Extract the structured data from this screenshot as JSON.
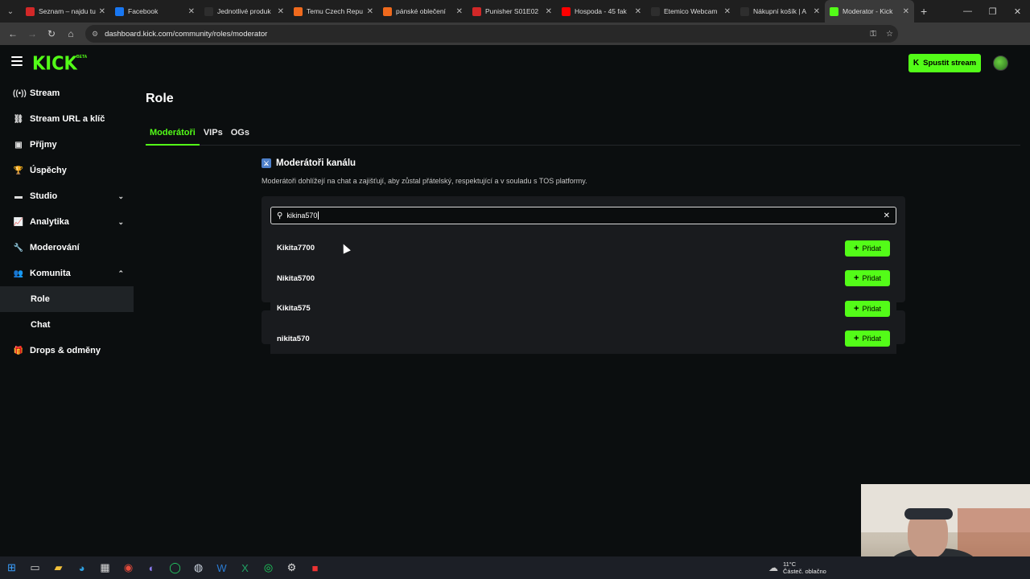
{
  "browser": {
    "tabs": [
      {
        "title": "Seznam – najdu tu",
        "favicon_color": "#d22828",
        "active": false
      },
      {
        "title": "Facebook",
        "favicon_color": "#1877f2",
        "active": false
      },
      {
        "title": "Jednotlivé produk",
        "favicon_color": "#2e2e2e",
        "active": false
      },
      {
        "title": "Temu Czech Repu",
        "favicon_color": "#f06a1d",
        "active": false
      },
      {
        "title": "pánské oblečení",
        "favicon_color": "#f06a1d",
        "active": false
      },
      {
        "title": "Punisher S01E02",
        "favicon_color": "#d22828",
        "active": false
      },
      {
        "title": "Hospoda - 45 fak",
        "favicon_color": "#ff0000",
        "active": false
      },
      {
        "title": "Etemico Webcam",
        "favicon_color": "#2e2e2e",
        "active": false
      },
      {
        "title": "Nákupní košík | A",
        "favicon_color": "#2e2e2e",
        "active": false
      },
      {
        "title": "Moderator - Kick",
        "favicon_color": "#53fc18",
        "active": true
      }
    ],
    "url": "dashboard.kick.com/community/roles/moderator"
  },
  "header": {
    "logo": "KICK",
    "logo_badge": "BETA",
    "stream_button": "Spustit stream"
  },
  "sidebar": {
    "items": [
      {
        "label": "Stream",
        "icon": "broadcast-icon",
        "glyph": "((•))"
      },
      {
        "label": "Stream URL a klíč",
        "icon": "link-icon",
        "glyph": "⛓"
      },
      {
        "label": "Příjmy",
        "icon": "wallet-icon",
        "glyph": "▣"
      },
      {
        "label": "Úspěchy",
        "icon": "trophy-icon",
        "glyph": "🏆"
      },
      {
        "label": "Studio",
        "icon": "studio-icon",
        "glyph": "▬",
        "chevron": "down"
      },
      {
        "label": "Analytika",
        "icon": "analytics-icon",
        "glyph": "📈",
        "chevron": "down"
      },
      {
        "label": "Moderování",
        "icon": "wrench-icon",
        "glyph": "🔧"
      },
      {
        "label": "Komunita",
        "icon": "community-icon",
        "glyph": "👥",
        "chevron": "up"
      },
      {
        "label": "Role",
        "sub": true,
        "active": true
      },
      {
        "label": "Chat",
        "sub": true
      },
      {
        "label": "Drops & odměny",
        "icon": "gift-icon",
        "glyph": "🎁"
      }
    ]
  },
  "main": {
    "title": "Role",
    "tabs": [
      "Moderátoři",
      "VIPs",
      "OGs"
    ],
    "section_title": "Moderátoři kanálu",
    "section_desc": "Moderátoři dohlížejí na chat a zajišťují, aby zůstal přátelský, respektující a v souladu s TOS platformy.",
    "search_value": "kikina570",
    "results": [
      {
        "name": "Kikita7700",
        "action": "Přidat"
      },
      {
        "name": "Nikita5700",
        "action": "Přidat"
      },
      {
        "name": "Kikita575",
        "action": "Přidat"
      },
      {
        "name": "nikita570",
        "action": "Přidat"
      }
    ]
  },
  "taskbar": {
    "weather_temp": "11°C",
    "weather_desc": "Částeč. oblačno"
  },
  "colors": {
    "accent": "#53fc18",
    "background": "#0b0e0f",
    "panel": "#191b1e"
  }
}
